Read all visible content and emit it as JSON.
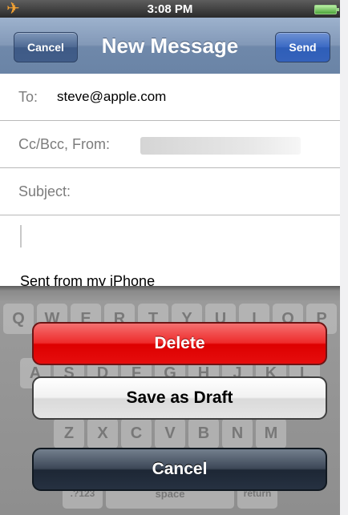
{
  "status_bar": {
    "time": "3:08 PM",
    "airplane_glyph": "✈"
  },
  "nav": {
    "title": "New Message",
    "cancel_label": "Cancel",
    "send_label": "Send"
  },
  "form": {
    "to_label": "To:",
    "to_value": "steve@apple.com",
    "ccbcc_label": "Cc/Bcc, From:",
    "subject_label": "Subject:",
    "signature": "Sent from my iPhone"
  },
  "keyboard": {
    "row1": [
      "Q",
      "W",
      "E",
      "R",
      "T",
      "Y",
      "U",
      "I",
      "O",
      "P"
    ],
    "row2": [
      "A",
      "S",
      "D",
      "F",
      "G",
      "H",
      "J",
      "K",
      "L"
    ],
    "row3": [
      "Z",
      "X",
      "C",
      "V",
      "B",
      "N",
      "M"
    ],
    "row4": [
      ".?123",
      "space",
      "return"
    ]
  },
  "action_sheet": {
    "delete_label": "Delete",
    "save_draft_label": "Save as Draft",
    "cancel_label": "Cancel"
  },
  "colors": {
    "nav_bar": "#8399b8",
    "delete": "#e60d0d",
    "cancel_dark": "#263141",
    "airplane": "#f3a233"
  }
}
